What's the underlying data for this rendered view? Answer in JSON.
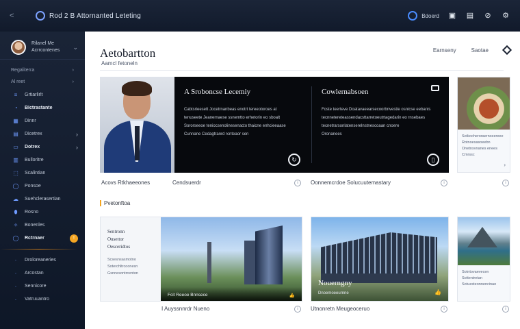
{
  "titlebar": {
    "back": "<",
    "title": "Rod 2 B Attornanted Leteting",
    "user": "Bdoerd",
    "icons": [
      "gallery-icon",
      "bookmark-icon",
      "link-icon",
      "settings-icon"
    ]
  },
  "sidebar": {
    "profile_line1": "Rilanel Me",
    "profile_line2": "Acrrcontenes",
    "section1": "Regaliterra",
    "section2": "Al reet",
    "items": [
      {
        "label": "Grtiarlirlt"
      },
      {
        "label": "Bictrastante"
      },
      {
        "label": "Dinnr"
      },
      {
        "label": "Dicetrex"
      },
      {
        "label": "Dotrex"
      },
      {
        "label": "Bulloritre"
      },
      {
        "label": "Scalintian"
      },
      {
        "label": "Ponsoe"
      },
      {
        "label": "Suehclerasertian"
      },
      {
        "label": "Rosno"
      },
      {
        "label": "Bonenles"
      },
      {
        "label": "Rctrnaer"
      }
    ],
    "badge": "!",
    "footer_items": [
      {
        "label": "Droloreaneries"
      },
      {
        "label": "Arcostan"
      },
      {
        "label": "Sennicore"
      },
      {
        "label": "Vatruuantro"
      }
    ]
  },
  "main": {
    "title": "Aetobartton",
    "subtitle": "Aamcl fetoneln",
    "actions": [
      "Earnseny",
      "Saotae"
    ],
    "feature": {
      "col1_title": "A Sroboncse Lecemiy",
      "col1_lines": [
        "Cabtsrieesett Jocetrnanbeas enotrt tereeotoroes at",
        "tenuseete Jeanernaese ssnemtto erhetorin eo sboalt",
        "Sororseeoe teniocsenolinesenacto thaicne enhcieeaase",
        "Cunnane Cedagtranrd rcnteaor sen"
      ],
      "col2_title": "Cowlernabsoen",
      "col2_lines": [
        "Foste teerteve Doatavaeearsecoorbnvestie osnicse eebanis",
        "tecnnetereteassendacsttarretoeutrtagedarin eo rnsebaes",
        "tecnetrarsonlatenserelnstnescoaan cnoere",
        "Oronanees"
      ],
      "side_text": "Sotkocheroraernceereee Rotnoesasoeebn Onetnsvnanes enees Cmrssc"
    },
    "captions": [
      "Acovs Rtkhaeeones",
      "Cendsuerdr",
      "Oonnemcrdoe Solucuutemastary"
    ],
    "section2": "Pvetonftoa",
    "lower": {
      "card1_lines": [
        "Sentronn",
        "Ousettor",
        "Oesceridtos"
      ],
      "card1_small": [
        "Scsesnsasmotno",
        "Soterchltrcoonesn",
        "Gsnnesontrcenton"
      ],
      "card1_overlay": "Fcit Reeoe Bnnsece",
      "card2_title": "Nouerngny",
      "card2_sub": "Dnoemoeeurnne",
      "card3_text": "Sotntovaevecen Sottentretan Sotuesteonnencinao"
    },
    "bottom_captions": [
      "I Auyssnnrdr Nueno",
      "Utnonretn Meugeoceruo"
    ]
  }
}
